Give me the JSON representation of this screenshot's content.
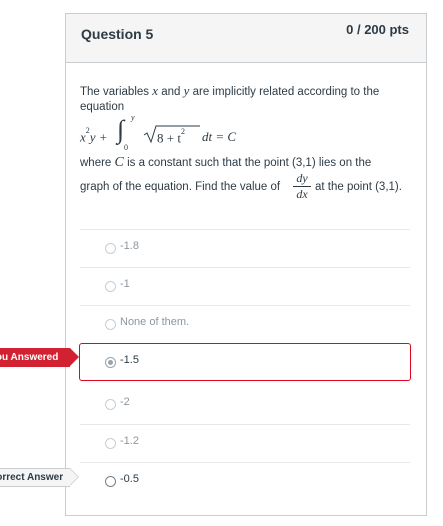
{
  "question": {
    "title": "Question 5",
    "points": "0 / 200 pts",
    "text_line1": "The variables",
    "var_x": "x",
    "and": "and",
    "var_y": "y",
    "text_line1_end": "are implicitly related according to the",
    "text_line2": "equation",
    "eq_lhs": "x",
    "eq_sup": "2",
    "eq_y_plus": "y +",
    "integral": "∫",
    "int_upper": "y",
    "int_lower": "0",
    "sqrt_content": "8 + t",
    "sqrt_sup": "2",
    "eq_rhs": "dt = C",
    "where": "where",
    "const_C": "C",
    "text_line4_end": "is a constant such that the point (3,1) lies on the",
    "text_line5_start": "graph of the equation. Find the value of",
    "frac_num": "dy",
    "frac_den": "dx",
    "text_line5_end": "at the point (3,1)."
  },
  "answers": [
    {
      "label": "-1.8"
    },
    {
      "label": "-1"
    },
    {
      "label": "None of them."
    },
    {
      "label": "-1.5"
    },
    {
      "label": "-2"
    },
    {
      "label": "-1.2"
    },
    {
      "label": "-0.5"
    }
  ],
  "flags": {
    "you_answered": "You Answered",
    "correct_answer": "Correct Answer"
  },
  "colors": {
    "incorrect_accent": "#e0061f",
    "flag_red": "#d22232"
  }
}
